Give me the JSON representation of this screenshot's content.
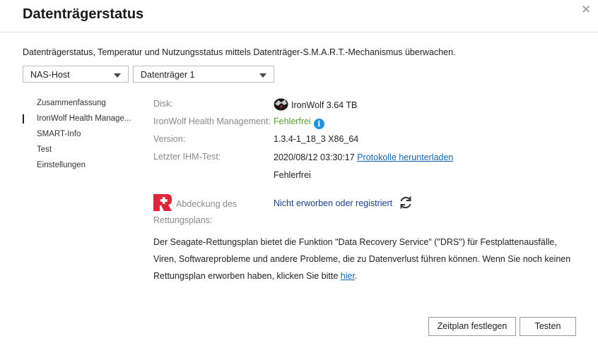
{
  "dialog": {
    "title": "Datenträgerstatus"
  },
  "description": "Datenträgerstatus, Temperatur und Nutzungsstatus mittels Datenträger-S.M.A.R.T.-Mechanismus überwachen.",
  "selects": {
    "host": "NAS-Host",
    "disk": "Datenträger 1"
  },
  "nav": [
    {
      "label": "Zusammenfassung",
      "active": false
    },
    {
      "label": "IronWolf Health Manage...",
      "active": true
    },
    {
      "label": "SMART-Info",
      "active": false
    },
    {
      "label": "Test",
      "active": false
    },
    {
      "label": "Einstellungen",
      "active": false
    }
  ],
  "details": {
    "disk_label": "Disk:",
    "disk_value": "IronWolf 3.64 TB",
    "ihm_label": "IronWolf Health Management:",
    "ihm_value": "Fehlerfrei",
    "version_label": "Version:",
    "version_value": "1.3.4-1_18_3 X86_64",
    "last_test_label": "Letzter IHM-Test:",
    "last_test_value": "2020/08/12 03:30:17",
    "download_link": "Protokolle herunterladen",
    "last_test_result": "Fehlerfrei",
    "rescue_label": "Abdeckung des Rettungsplans:",
    "rescue_value": "Nicht erworben oder registriert"
  },
  "paragraph": {
    "text": "Der Seagate-Rettungsplan bietet die Funktion \"Data Recovery Service\" (\"DRS\") für Festplattenausfälle, Viren, Softwareprobleme und andere Probleme, die zu Datenverlust führen können. Wenn Sie noch keinen Rettungsplan erworben haben, klicken Sie bitte ",
    "link": "hier",
    "suffix": "."
  },
  "buttons": {
    "schedule": "Zeitplan festlegen",
    "test": "Testen"
  },
  "icons": {
    "close": "close-icon",
    "info": "info-icon",
    "refresh": "refresh-icon",
    "rescue": "rescue-logo-icon",
    "disk": "ironwolf-disk-icon"
  },
  "colors": {
    "ok": "#5aa02c",
    "link": "#1466b0",
    "info": "#1f92dd",
    "rescue": "#e0243a"
  }
}
